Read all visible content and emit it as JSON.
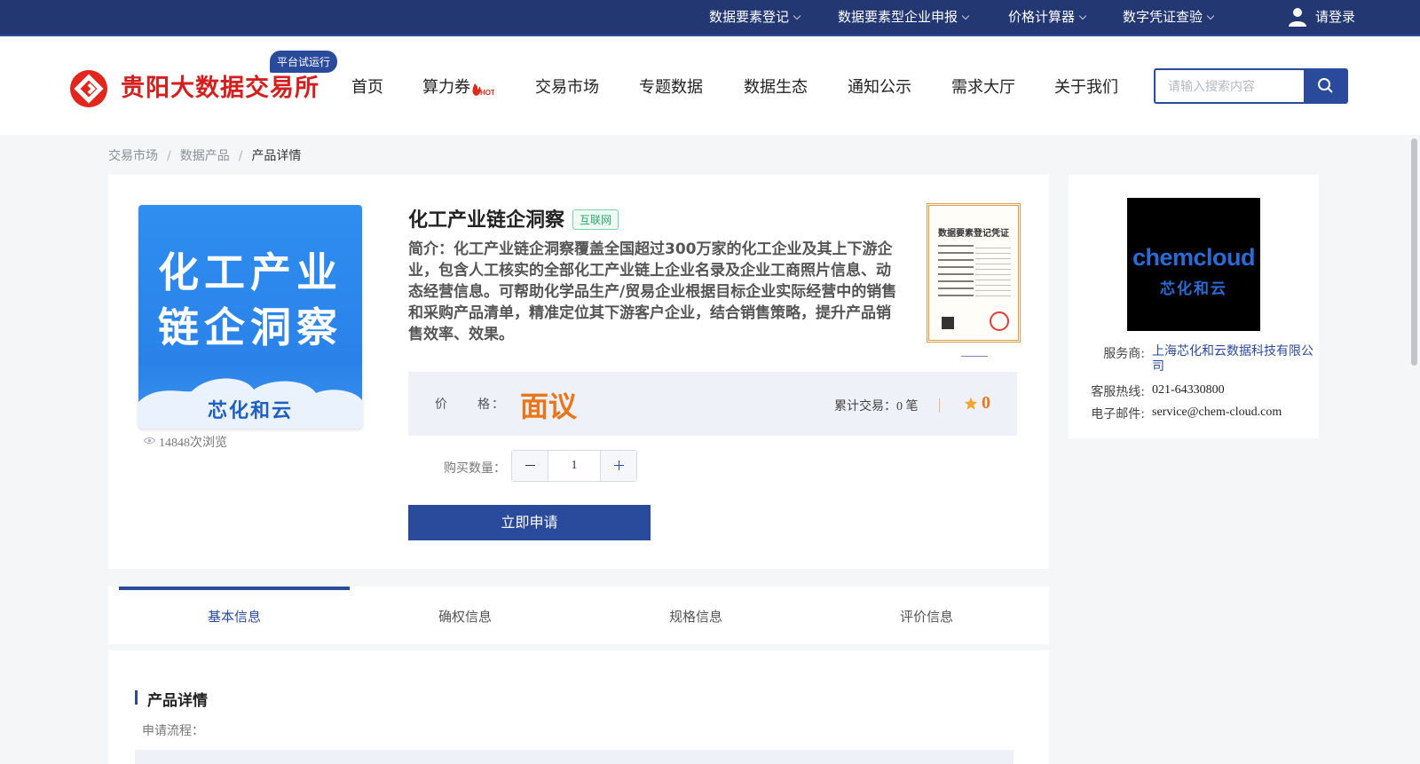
{
  "topbar": {
    "items": [
      {
        "label": "数据要素登记"
      },
      {
        "label": "数据要素型企业申报"
      },
      {
        "label": "价格计算器"
      },
      {
        "label": "数字凭证查验"
      }
    ],
    "login_label": "请登录"
  },
  "header": {
    "logo_text": "贵阳大数据交易所",
    "trial_badge": "平台试运行",
    "nav": [
      {
        "label": "首页"
      },
      {
        "label": "算力券"
      },
      {
        "label": "交易市场"
      },
      {
        "label": "专题数据"
      },
      {
        "label": "数据生态"
      },
      {
        "label": "通知公示"
      },
      {
        "label": "需求大厅"
      },
      {
        "label": "关于我们"
      }
    ],
    "hot_badge": "HOT",
    "search_placeholder": "请输入搜索内容"
  },
  "breadcrumb": [
    "交易市场",
    "数据产品",
    "产品详情"
  ],
  "product": {
    "image_lines": [
      "化工产业",
      "链企洞察"
    ],
    "image_brand": "芯化和云",
    "views": "14848次浏览",
    "title": "化工产业链企洞察",
    "tag": "互联网",
    "intro": "简介：化工产业链企洞察覆盖全国超过300万家的化工企业及其上下游企业，包含人工核实的全部化工产业链上企业名录及企业工商照片信息、动态经营信息。可帮助化学品生产/贸易企业根据目标企业实际经营中的销售和采购产品清单，精准定位其下游客户企业，结合销售策略，提升产品销售效率、效果。",
    "certificate_title": "数据要素登记凭证",
    "price_label": "价　　格：",
    "price_value": "面议",
    "trade_text": "累计交易：0 笔",
    "rating": "0",
    "qty_label": "购买数量：",
    "qty_value": "1",
    "apply_label": "立即申请"
  },
  "tabs": [
    {
      "label": "基本信息"
    },
    {
      "label": "确权信息"
    },
    {
      "label": "规格信息"
    },
    {
      "label": "评价信息"
    }
  ],
  "detail": {
    "heading": "产品详情",
    "flow_label": "申请流程："
  },
  "provider": {
    "logo_en": "chemcloud",
    "logo_cn": "芯化和云",
    "rows": [
      {
        "key": "服务商:",
        "value": "上海芯化和云数据科技有限公司"
      },
      {
        "key": "客服热线:",
        "value": "021-64330800"
      },
      {
        "key": "电子邮件:",
        "value": "service@chem-cloud.com"
      }
    ]
  },
  "colors": {
    "primary": "#2a4a9b",
    "topbar": "#233773",
    "logo_red": "#d41f1f",
    "price_orange": "#e8771b",
    "tag_green": "#2aa86a"
  }
}
